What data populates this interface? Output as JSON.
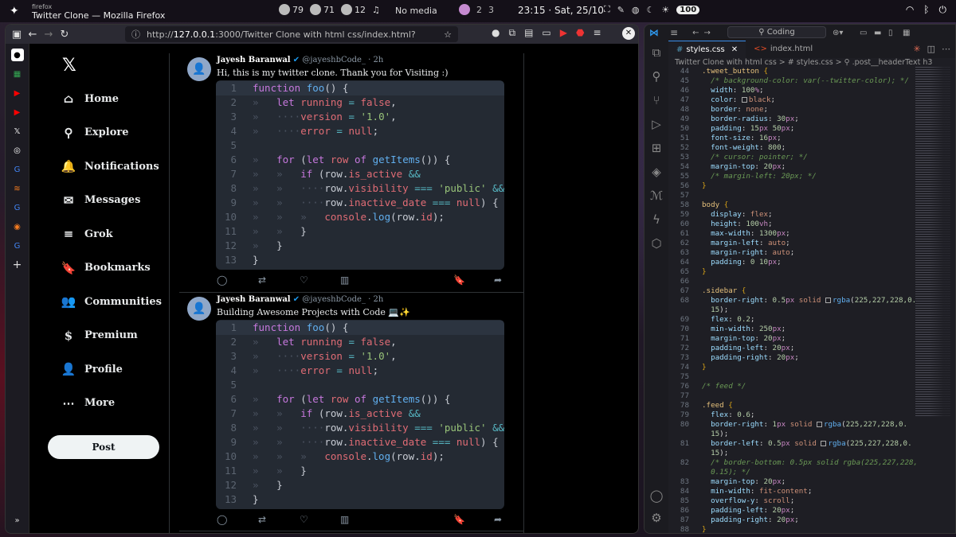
{
  "topbar": {
    "app_class": "firefox",
    "window_title": "Twitter Clone — Mozilla Firefox",
    "stats": [
      "79",
      "71",
      "12"
    ],
    "media": "No media",
    "workspaces": [
      "2",
      "3"
    ],
    "clock": "23:15 · Sat, 25/10",
    "battery": "100"
  },
  "browser": {
    "url_prefix": "http://",
    "url_host": "127.0.0.1",
    "url_rest": ":3000/Twitter Clone with html css/index.html?"
  },
  "twitter": {
    "nav": [
      {
        "icon": "⌂",
        "label": "Home"
      },
      {
        "icon": "⚲",
        "label": "Explore"
      },
      {
        "icon": "🔔",
        "label": "Notifications"
      },
      {
        "icon": "✉",
        "label": "Messages"
      },
      {
        "icon": "≡",
        "label": "Grok"
      },
      {
        "icon": "🔖",
        "label": "Bookmarks"
      },
      {
        "icon": "👥",
        "label": "Communities"
      },
      {
        "icon": "$",
        "label": "Premium"
      },
      {
        "icon": "👤",
        "label": "Profile"
      },
      {
        "icon": "⋯",
        "label": "More"
      }
    ],
    "post_label": "Post",
    "tweets": [
      {
        "name": "Jayesh Baranwal",
        "handle": "@jayeshbCode_ · 2h",
        "text": "Hi, this is my twitter clone. Thank you for Visiting :)"
      },
      {
        "name": "Jayesh Baranwal",
        "handle": "@jayeshbCode_ · 2h",
        "text": "Building Awesome Projects with Code 💻✨"
      }
    ],
    "code_line_numbers": [
      "1",
      "2",
      "3",
      "4",
      "5",
      "6",
      "7",
      "8",
      "9",
      "10",
      "11",
      "12",
      "13"
    ]
  },
  "vscode": {
    "search": "Coding",
    "tabs": [
      "styles.css",
      "index.html"
    ],
    "breadcrumb": "Twitter Clone with html css  >  # styles.css  >  ⚲ .post__headerText h3",
    "line_numbers": [
      "44",
      "45",
      "46",
      "47",
      "48",
      "49",
      "50",
      "51",
      "52",
      "53",
      "54",
      "55",
      "56",
      "57",
      "58",
      "59",
      "60",
      "61",
      "62",
      "63",
      "64",
      "65",
      "66",
      "67",
      "68",
      "",
      "69",
      "70",
      "71",
      "72",
      "73",
      "74",
      "75",
      "76",
      "77",
      "78",
      "79",
      "80",
      "",
      "81",
      "",
      "82",
      "",
      "83",
      "84",
      "85",
      "86",
      "87",
      "88"
    ]
  }
}
